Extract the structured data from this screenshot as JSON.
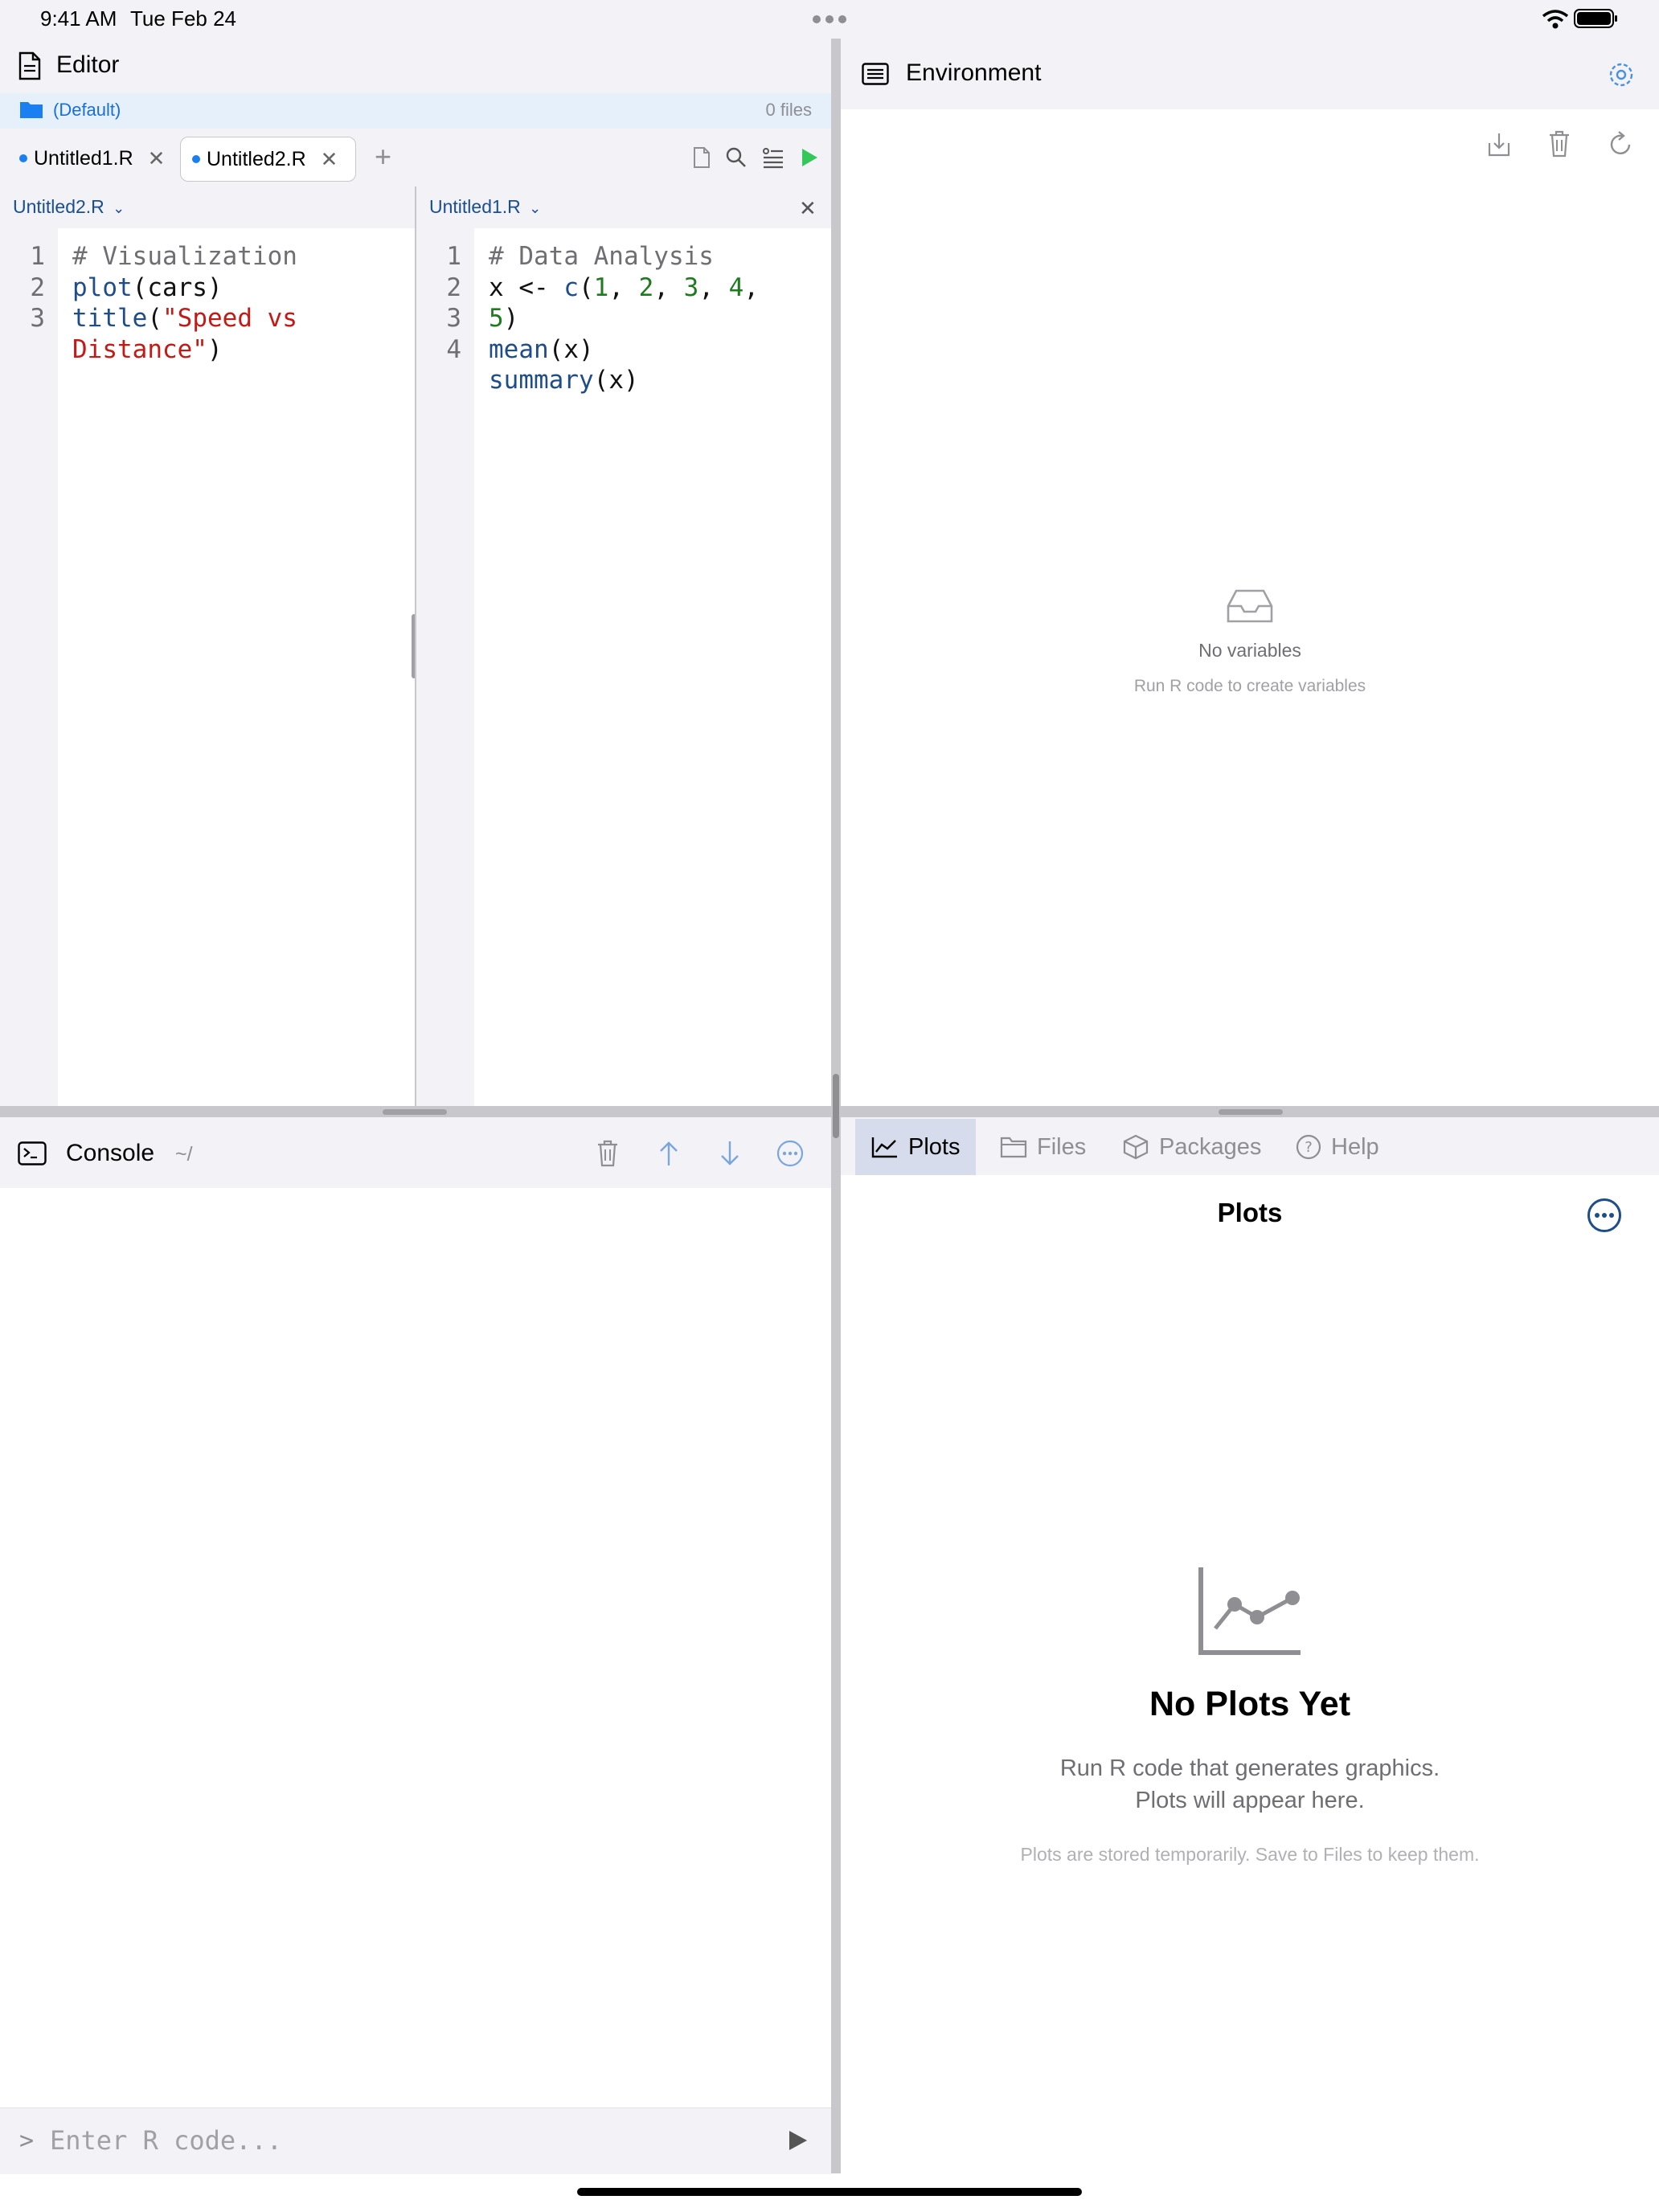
{
  "status_bar": {
    "time": "9:41 AM",
    "date": "Tue Feb 24"
  },
  "editor": {
    "title": "Editor",
    "project": {
      "name": "(Default)",
      "file_count": "0 files"
    },
    "tabs": [
      {
        "label": "Untitled1.R",
        "active": false
      },
      {
        "label": "Untitled2.R",
        "active": true
      }
    ],
    "panes": [
      {
        "file": "Untitled2.R",
        "line_numbers": [
          "1",
          "2",
          "3"
        ],
        "lines": [
          [
            {
              "t": "# Visualization",
              "c": "comment"
            }
          ],
          [
            {
              "t": "plot",
              "c": "fn"
            },
            {
              "t": "(cars)",
              "c": "plain"
            }
          ],
          [
            {
              "t": "title",
              "c": "fn"
            },
            {
              "t": "(",
              "c": "plain"
            },
            {
              "t": "\"Speed vs",
              "c": "str"
            }
          ],
          [
            {
              "t": "Distance\"",
              "c": "str"
            },
            {
              "t": ")",
              "c": "plain"
            }
          ]
        ]
      },
      {
        "file": "Untitled1.R",
        "line_numbers": [
          "1",
          "2",
          "3",
          "4"
        ],
        "lines": [
          [
            {
              "t": "# Data Analysis",
              "c": "comment"
            }
          ],
          [
            {
              "t": "x <- ",
              "c": "plain"
            },
            {
              "t": "c",
              "c": "fn"
            },
            {
              "t": "(",
              "c": "plain"
            },
            {
              "t": "1",
              "c": "num"
            },
            {
              "t": ", ",
              "c": "plain"
            },
            {
              "t": "2",
              "c": "num"
            },
            {
              "t": ", ",
              "c": "plain"
            },
            {
              "t": "3",
              "c": "num"
            },
            {
              "t": ", ",
              "c": "plain"
            },
            {
              "t": "4",
              "c": "num"
            },
            {
              "t": ",",
              "c": "plain"
            }
          ],
          [
            {
              "t": "5",
              "c": "num"
            },
            {
              "t": ")",
              "c": "plain"
            }
          ],
          [
            {
              "t": "mean",
              "c": "fn"
            },
            {
              "t": "(x)",
              "c": "plain"
            }
          ],
          [
            {
              "t": "summary",
              "c": "fn"
            },
            {
              "t": "(x)",
              "c": "plain"
            }
          ]
        ]
      }
    ]
  },
  "environment": {
    "title": "Environment",
    "empty_title": "No variables",
    "empty_hint": "Run R code to create variables"
  },
  "console": {
    "title": "Console",
    "path": "~/",
    "prompt": ">",
    "input_placeholder": "Enter R code..."
  },
  "plots_panel": {
    "tabs": [
      "Plots",
      "Files",
      "Packages",
      "Help"
    ],
    "active_tab": "Plots",
    "heading": "Plots",
    "empty_title": "No Plots Yet",
    "empty_sub1": "Run R code that generates graphics.",
    "empty_sub2": "Plots will appear here.",
    "note": "Plots are stored temporarily. Save to Files to keep them."
  },
  "colors": {
    "accent": "#1a7ff0",
    "run_green": "#34c759",
    "code_function": "#1f4d8a",
    "code_string": "#c41a16",
    "code_number": "#1e7b1e",
    "code_comment": "#6e6e73"
  },
  "icons": [
    "document-icon",
    "folder-icon",
    "file-icon",
    "search-icon",
    "outline-icon",
    "run-icon",
    "env-list-icon",
    "settings-icon",
    "import-icon",
    "trash-icon",
    "refresh-icon",
    "inbox-icon",
    "terminal-icon",
    "arrow-up-icon",
    "arrow-down-icon",
    "more-icon",
    "chart-icon",
    "folder-icon",
    "package-icon",
    "help-icon",
    "send-icon"
  ]
}
